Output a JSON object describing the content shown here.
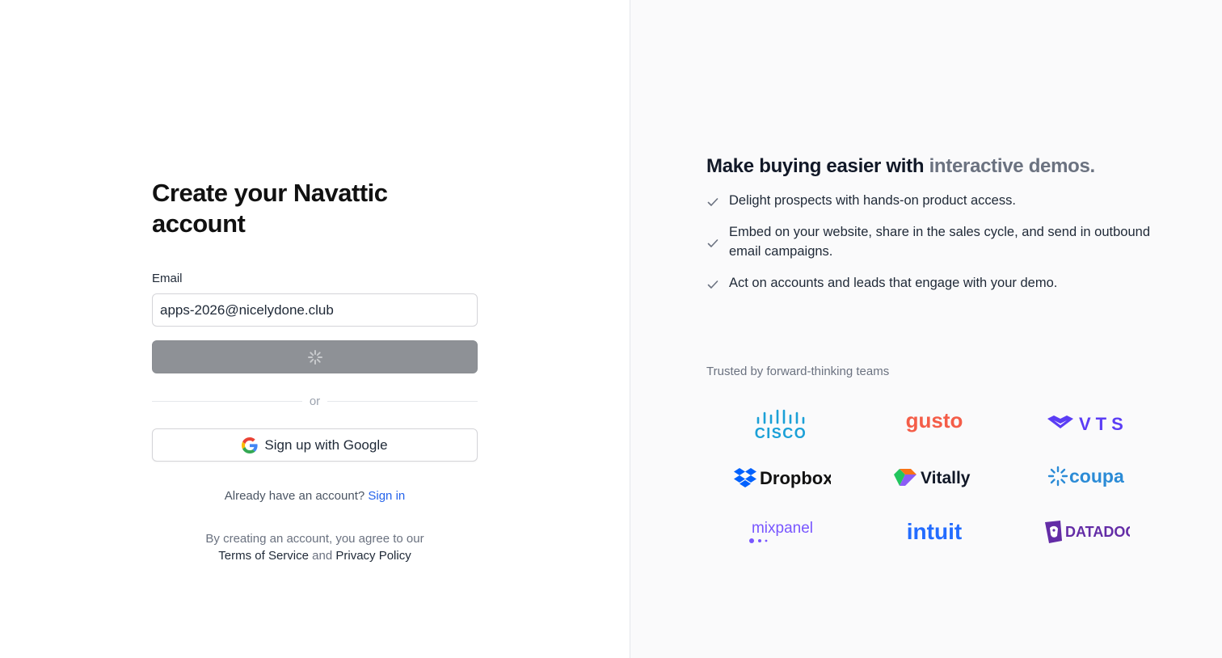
{
  "signup": {
    "title": "Create your Navattic account",
    "email_label": "Email",
    "email_value": "apps-2026@nicelydone.club",
    "divider": "or",
    "google_button": "Sign up with Google",
    "already_text": "Already have an account?",
    "sign_in": "Sign in",
    "terms_prefix": "By creating an account, you agree to our",
    "terms_link": "Terms of Service",
    "terms_and": "and",
    "privacy_link": "Privacy Policy"
  },
  "pitch": {
    "headline_main": "Make buying easier with",
    "headline_accent": "interactive demos.",
    "features": [
      "Delight prospects with hands-on product access.",
      "Embed on your website, share in the sales cycle, and send in outbound email campaigns.",
      "Act on accounts and leads that engage with your demo."
    ],
    "trusted": "Trusted by forward-thinking teams"
  },
  "logos": [
    {
      "name": "cisco",
      "text": "CISCO",
      "color": "#1ba0d7"
    },
    {
      "name": "gusto",
      "text": "gusto",
      "color": "#f45d48"
    },
    {
      "name": "vts",
      "text": "VTS",
      "color": "#5b3df5"
    },
    {
      "name": "dropbox",
      "text": "Dropbox",
      "color": "#0061fe"
    },
    {
      "name": "vitally",
      "text": "Vitally",
      "color": "#111827"
    },
    {
      "name": "coupa",
      "text": "coupa",
      "color": "#2b8bd6"
    },
    {
      "name": "mixpanel",
      "text": "mixpanel",
      "color": "#7856ff"
    },
    {
      "name": "intuit",
      "text": "intuit",
      "color": "#236cff"
    },
    {
      "name": "datadog",
      "text": "DATADOG",
      "color": "#632ca6"
    }
  ],
  "colors": {
    "link": "#2563eb",
    "submit_loading": "#8e9196"
  }
}
